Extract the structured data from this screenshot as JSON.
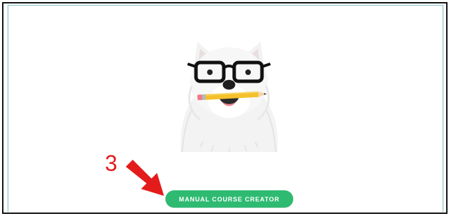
{
  "annotation": {
    "step_number": "3",
    "color": "#e31b1b"
  },
  "mascot": {
    "icon": "samoyed-dog-with-glasses-and-pencil-icon"
  },
  "cta": {
    "label": "MANUAL COURSE CREATOR",
    "color": "#2fba72"
  }
}
